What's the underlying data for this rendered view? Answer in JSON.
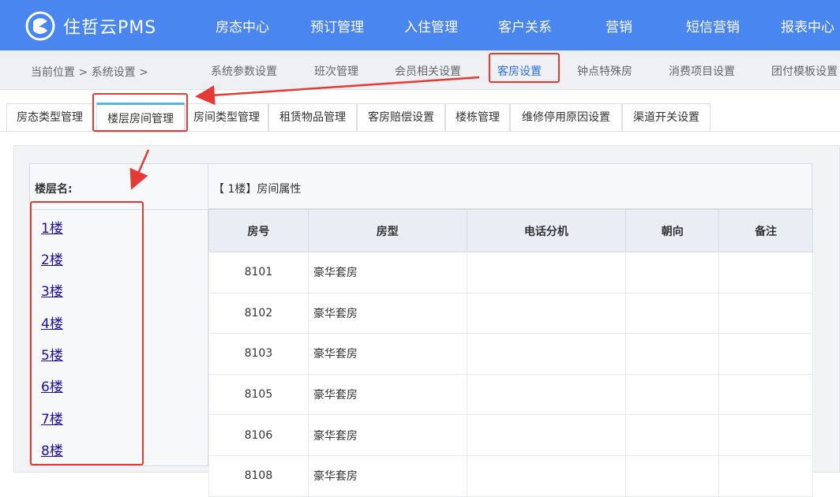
{
  "header": {
    "brand": "住哲云PMS",
    "nav": [
      "房态中心",
      "预订管理",
      "入住管理",
      "客户关系",
      "营销",
      "短信营销",
      "报表中心"
    ]
  },
  "subnav": {
    "breadcrumb": "当前位置 > 系统设置 >",
    "items": [
      "系统参数设置",
      "班次管理",
      "会员相关设置",
      "客房设置",
      "钟点特殊房",
      "消费项目设置",
      "团付模板设置"
    ],
    "active": "客房设置"
  },
  "tabs": [
    "房态类型管理",
    "楼层房间管理",
    "房间类型管理",
    "租赁物品管理",
    "客房赔偿设置",
    "楼栋管理",
    "维修停用原因设置",
    "渠道开关设置"
  ],
  "floor_panel": {
    "header": "楼层名:",
    "floors": [
      "1楼",
      "2楼",
      "3楼",
      "4楼",
      "5楼",
      "6楼",
      "7楼",
      "8楼"
    ]
  },
  "room_panel": {
    "header": "【 1楼】房间属性",
    "columns": [
      "房号",
      "房型",
      "电话分机",
      "朝向",
      "备注"
    ],
    "rows": [
      [
        "8101",
        "豪华套房",
        "",
        "",
        ""
      ],
      [
        "8102",
        "豪华套房",
        "",
        "",
        ""
      ],
      [
        "8103",
        "豪华套房",
        "",
        "",
        ""
      ],
      [
        "8105",
        "豪华套房",
        "",
        "",
        ""
      ],
      [
        "8106",
        "豪华套房",
        "",
        "",
        ""
      ],
      [
        "8108",
        "豪华套房",
        "",
        "",
        ""
      ]
    ]
  },
  "colors": {
    "brand_blue": "#4a86f0",
    "annotation_red": "#e53935",
    "link": "#1a0dab"
  }
}
